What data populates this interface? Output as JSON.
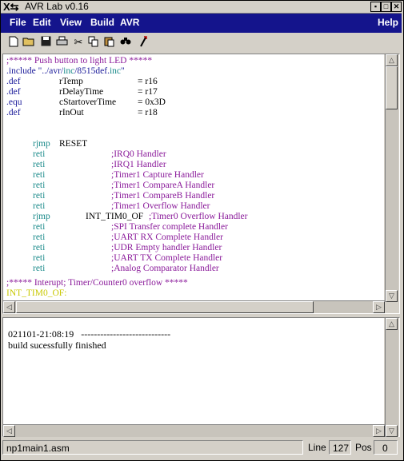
{
  "window": {
    "title": "AVR Lab v0.16",
    "system_icon": "X⇆"
  },
  "title_buttons": {
    "minimize": "▪",
    "maximize": "□",
    "close": "✕"
  },
  "menubar": {
    "file": "File",
    "edit": "Edit",
    "view": "View",
    "build": "Build",
    "avr": "AVR",
    "help": "Help"
  },
  "toolbar": {
    "icons": [
      "new-file-icon",
      "open-folder-icon",
      "save-disk-icon",
      "print-icon",
      "cut-scissors-icon",
      "copy-icon",
      "paste-icon",
      "find-binoculars-icon",
      "build-wand-icon"
    ]
  },
  "editor": {
    "lines": [
      ";***** Push button to light LED *****",
      ".include \"../avr/inc/8515def.inc\"",
      ".def",
      "rTemp",
      "= r16",
      ".def",
      "rDelayTime",
      "= r17",
      ".equ",
      "cStartoverTime",
      "= 0x3D",
      ".def",
      "rInOut",
      "= r18",
      "rjmp",
      "RESET",
      "reti",
      ";IRQ0 Handler",
      "reti",
      ";IRQ1 Handler",
      "reti",
      ";Timer1 Capture Handler",
      "reti",
      ";Timer1 CompareA Handler",
      "reti",
      ";Timer1 CompareB Handler",
      "reti",
      ";Timer1 Overflow Handler",
      "rjmp",
      "INT_TIM0_OF",
      ";Timer0 Overflow Handler",
      "reti",
      ";SPI Transfer complete Handler",
      "reti",
      ";UART RX Complete Handler",
      "reti",
      ";UDR Empty handler Handler",
      "reti",
      ";UART TX Complete Handler",
      "reti",
      ";Analog Comparator Handler",
      ";***** Interupt; Timer/Counter0 overflow *****",
      "INT_TIM0_OF:"
    ]
  },
  "output": {
    "line1": "021101-21:08:19   ----------------------------",
    "line2": "build sucessfully finished"
  },
  "statusbar": {
    "filename": "np1main1.asm",
    "line_label": "Line",
    "line_value": "127",
    "pos_label": "Pos",
    "pos_value": "0"
  }
}
